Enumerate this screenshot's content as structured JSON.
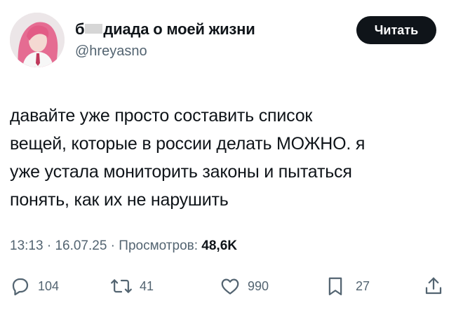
{
  "author": {
    "display_name_prefix": "б",
    "display_name_suffix": "диада о моей жизни",
    "handle": "@hreyasno"
  },
  "follow_button": {
    "label": "Читать"
  },
  "tweet": {
    "text": "давайте уже просто составить список\nвещей, которые в россии делать МОЖНО. я\nуже устала мониторить законы и пытаться\nпонять, как их не нарушить"
  },
  "meta": {
    "time": "13:13",
    "separator1": " · ",
    "date": "16.07.25",
    "separator2": " · ",
    "views_label": "Просмотров: ",
    "views_count": "48,6K"
  },
  "actions": {
    "replies": "104",
    "retweets": "41",
    "likes": "990",
    "bookmarks": "27"
  },
  "icons": {
    "reply": "speech-bubble-icon",
    "retweet": "retweet-arrows-icon",
    "like": "heart-icon",
    "bookmark": "bookmark-icon",
    "share": "share-upload-icon"
  },
  "colors": {
    "text": "#0f1419",
    "secondary": "#536471",
    "button_bg": "#0f1419",
    "button_text": "#ffffff"
  }
}
